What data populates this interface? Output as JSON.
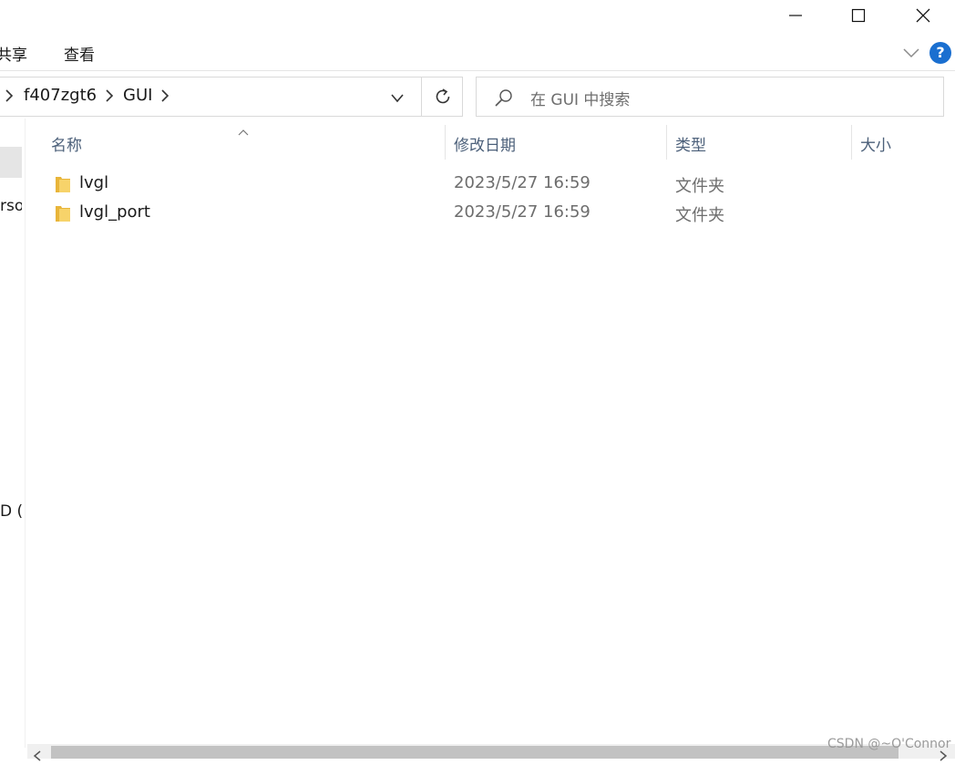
{
  "window": {
    "controls": [
      "minimize-icon",
      "maximize-icon",
      "close-icon"
    ]
  },
  "ribbon": {
    "tabs": [
      "共享",
      "查看"
    ],
    "visible_fragment_share": "共享",
    "help_label": "?",
    "accent": "#1a6fd0"
  },
  "address_bar": {
    "breadcrumbs": [
      "f407zgt6",
      "GUI"
    ]
  },
  "search": {
    "placeholder": "在 GUI 中搜索"
  },
  "nav_pane": {
    "fragments": [
      "rso",
      "D ("
    ]
  },
  "columns": {
    "name": "名称",
    "date": "修改日期",
    "type": "类型",
    "size": "大小"
  },
  "files": [
    {
      "name": "lvgl",
      "modified": "2023/5/27 16:59",
      "type": "文件夹"
    },
    {
      "name": "lvgl_port",
      "modified": "2023/5/27 16:59",
      "type": "文件夹"
    }
  ],
  "watermark": "CSDN @~O'Connor",
  "colors": {
    "folder": "#f3c94b",
    "header_text": "#4c607a"
  }
}
